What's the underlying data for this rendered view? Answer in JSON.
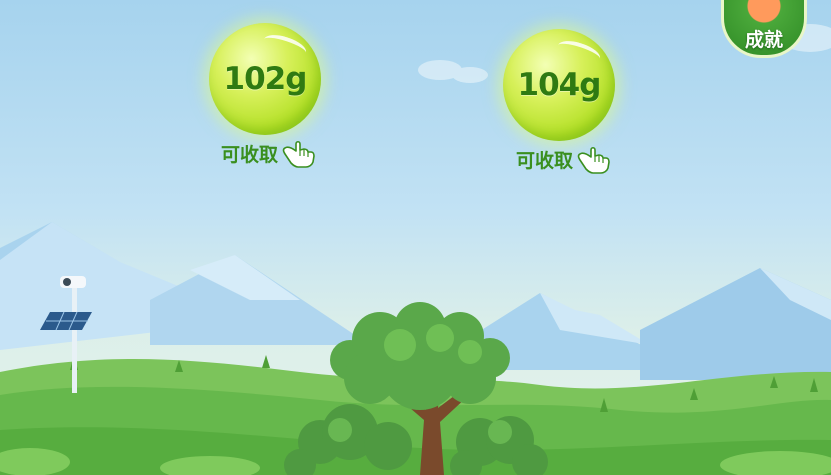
{
  "bubbles": [
    {
      "amount": "102g",
      "action_label": "可收取"
    },
    {
      "amount": "104g",
      "action_label": "可收取"
    }
  ],
  "achievement": {
    "label": "成就"
  },
  "icons": [
    "hand-pointer-icon",
    "solar-lamp-icon",
    "tree-icon",
    "mountains"
  ],
  "colors": {
    "sky": "#a6d3ee",
    "grass": "#5fb84a",
    "bubble": "#b3e026",
    "text_green": "#2f7a12"
  }
}
